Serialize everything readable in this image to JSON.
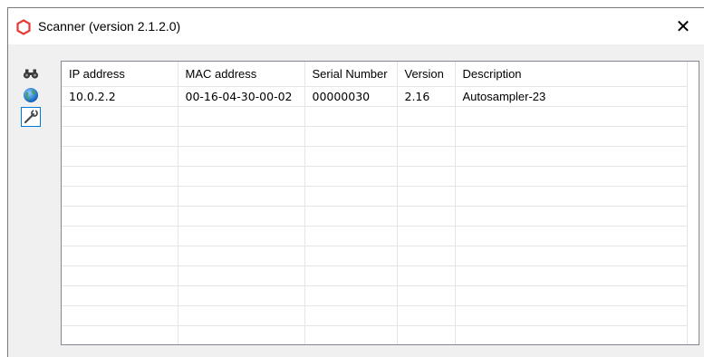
{
  "window": {
    "title": "Scanner (version 2.1.2.0)",
    "close_label": "✕"
  },
  "toolbar": {
    "items": [
      {
        "name": "binoculars-icon"
      },
      {
        "name": "globe-icon"
      },
      {
        "name": "wrench-icon",
        "active": true
      }
    ]
  },
  "table": {
    "columns": [
      "IP address",
      "MAC address",
      "Serial Number",
      "Version",
      "Description"
    ],
    "rows": [
      [
        "10.0.2.2",
        "00-16-04-30-00-02",
        "00000030",
        "2.16",
        "Autosampler-23"
      ]
    ],
    "empty_rows": 12
  },
  "colors": {
    "accent": "#0078d7",
    "app_icon": "#e53935"
  }
}
